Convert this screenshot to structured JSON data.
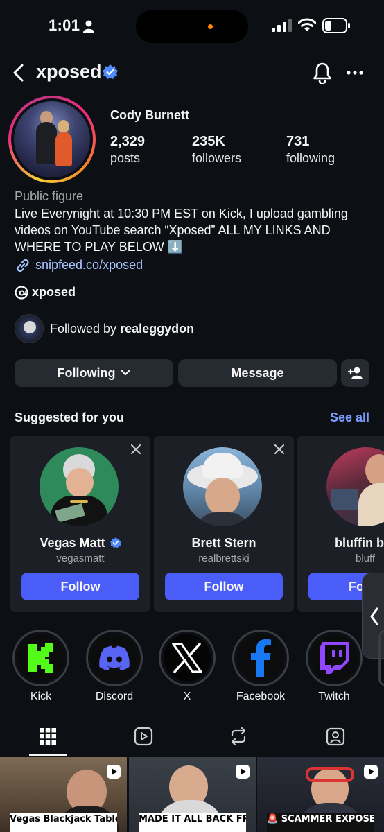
{
  "status_bar": {
    "time": "1:01"
  },
  "header": {
    "username": "xposed"
  },
  "profile": {
    "full_name": "Cody Burnett",
    "stats": [
      {
        "value": "2,329",
        "label": "posts"
      },
      {
        "value": "235K",
        "label": "followers"
      },
      {
        "value": "731",
        "label": "following"
      }
    ],
    "category": "Public figure",
    "bio": "Live Everynight at 10:30 PM EST on Kick, I upload gambling videos on YouTube search “Xposed” ALL MY LINKS AND WHERE TO PLAY BELOW ⬇️",
    "link": "snipfeed.co/xposed",
    "threads_handle": "xposed",
    "followed_by_prefix": "Followed by ",
    "followed_by_user": "realeggydon"
  },
  "actions": {
    "following": "Following",
    "message": "Message"
  },
  "suggested": {
    "title": "Suggested for you",
    "see_all": "See all",
    "cards": [
      {
        "name": "Vegas Matt",
        "handle": "vegasmatt",
        "verified": true,
        "button": "Follow"
      },
      {
        "name": "Brett Stern",
        "handle": "realbrettski",
        "verified": false,
        "button": "Follow"
      },
      {
        "name": "bluffin b",
        "handle": "bluff",
        "verified": false,
        "button": "Fo"
      }
    ]
  },
  "highlights": [
    {
      "label": "Kick",
      "icon": "kick-icon"
    },
    {
      "label": "Discord",
      "icon": "discord-icon"
    },
    {
      "label": "X",
      "icon": "x-icon"
    },
    {
      "label": "Facebook",
      "icon": "facebook-icon"
    },
    {
      "label": "Twitch",
      "icon": "twitch-icon"
    }
  ],
  "posts": [
    {
      "caption": "Vegas Blackjack Table"
    },
    {
      "caption": "MADE IT ALL BACK FROM ONE"
    },
    {
      "caption": "🚨 SCAMMER EXPOSED 🚨"
    }
  ],
  "colors": {
    "accent_blue": "#4a5df9",
    "link": "#a8c4ff",
    "see_all": "#7b9dff",
    "verified": "#4f8bff"
  }
}
